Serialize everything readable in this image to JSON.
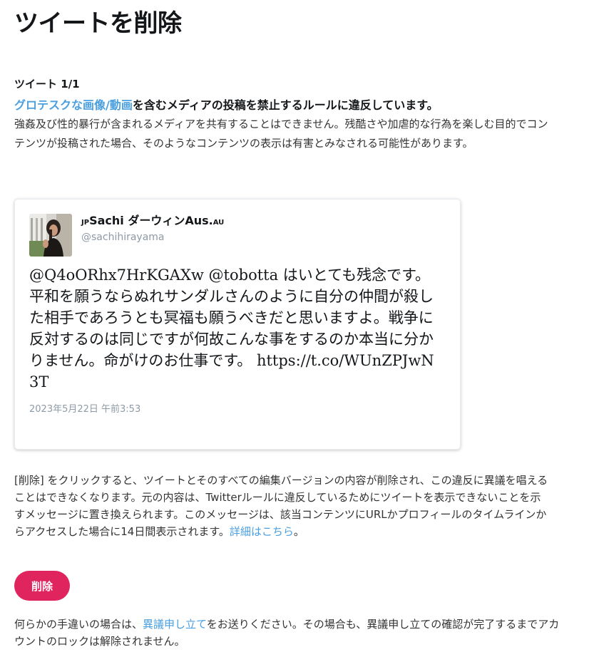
{
  "page": {
    "title": "ツイートを削除"
  },
  "violation": {
    "tweet_count": "ツイート 1/1",
    "rule_link": "グロテスクな画像/動画",
    "headline_rest": "を含むメディアの投稿を禁止するルールに違反しています。",
    "description": "強姦及び性的暴行が含まれるメディアを共有することはできません。残酷さや加虐的な行為を楽しむ目的でコンテンツが投稿された場合、そのようなコンテンツの表示は有害とみなされる可能性があります。"
  },
  "tweet": {
    "name_prefix": "JP",
    "name_main": "Sachi ダーウィンAus.",
    "name_suffix": "AU",
    "handle": "@sachihirayama",
    "text": "@Q4oORhx7HrKGAXw @tobotta はいとても残念です。平和を願うならぬれサンダルさんのように自分の仲間が殺した相手であろうとも冥福も願うべきだと思いますよ。戦争に反対するのは同じですが何故こんな事をするのか本当に分かりません。命がけのお仕事です。 https://t.co/WUnZPJwN3T",
    "timestamp": "2023年5月22日 午前3:53"
  },
  "explanation": {
    "text": "[削除] をクリックすると、ツイートとそのすべての編集バージョンの内容が削除され、この違反に異議を唱えることはできなくなります。元の内容は、Twitterルールに違反しているためにツイートを表示できないことを示すメッセージに置き換えられます。このメッセージは、該当コンテンツにURLかプロフィールのタイムラインからアクセスした場合に14日間表示されます。",
    "learn_more": "詳細はこちら",
    "end": "。"
  },
  "actions": {
    "delete_label": "削除"
  },
  "footer": {
    "before": "何らかの手違いの場合は、",
    "appeal_link": "異議申し立て",
    "after": "をお送りください。その場合も、異議申し立ての確認が完了するまでアカウントのロックは解除されません。"
  },
  "colors": {
    "link": "#4a9fe0",
    "delete_button": "#e0245e",
    "muted_text": "#8e9aa5"
  }
}
